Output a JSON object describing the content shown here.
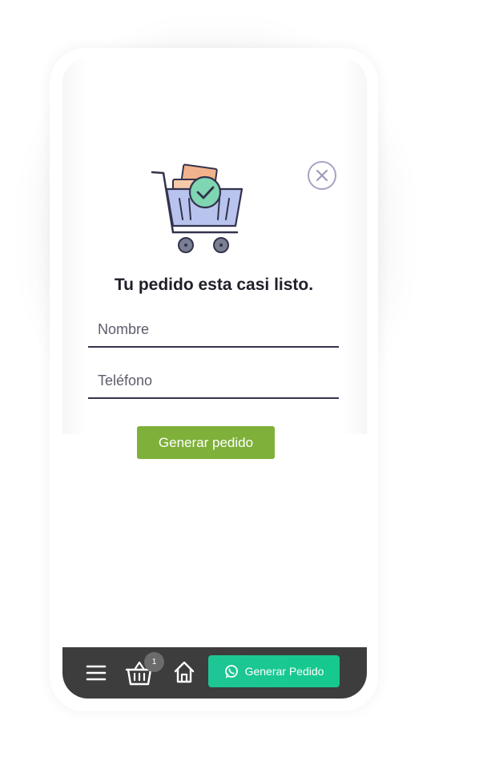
{
  "modal": {
    "title": "Tu pedido esta casi listo.",
    "name_placeholder": "Nombre",
    "phone_placeholder": "Teléfono",
    "submit_label": "Generar pedido"
  },
  "bottom_bar": {
    "basket_count": "1",
    "whatsapp_label": "Generar Pedido"
  },
  "icons": {
    "illustration": "shopping-cart-check-icon",
    "close": "close-icon",
    "menu": "menu-icon",
    "basket": "basket-icon",
    "home": "home-icon",
    "whatsapp": "whatsapp-icon"
  },
  "colors": {
    "submit_button": "#7fb03a",
    "whatsapp_button": "#1ec696",
    "bottom_bar": "#3d3d3d",
    "input_underline": "#33334d",
    "close_ring": "#a8a3c4"
  }
}
